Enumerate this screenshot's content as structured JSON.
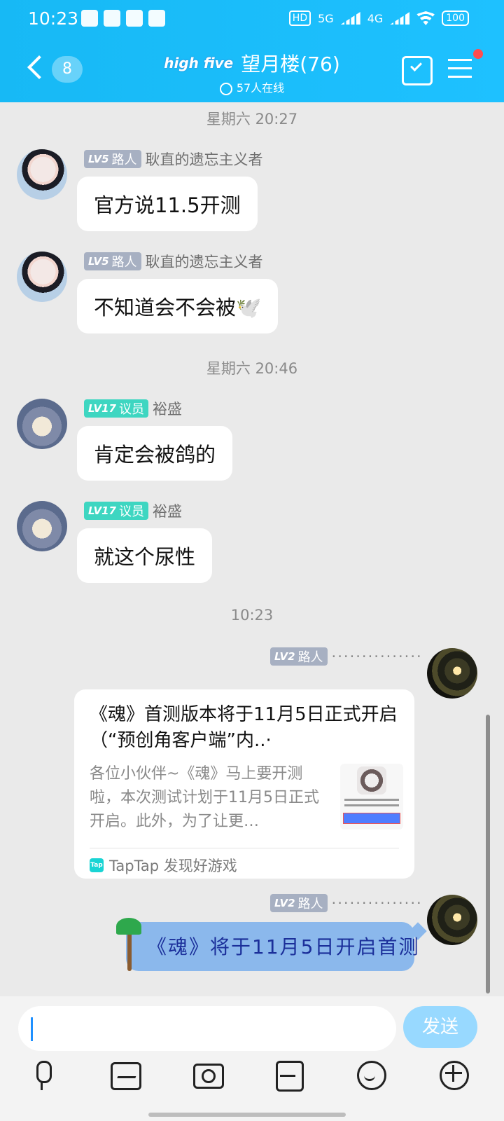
{
  "status": {
    "time": "10:23",
    "battery": "100",
    "network1": "5G",
    "network2": "4G",
    "hd_label": "HD"
  },
  "header": {
    "unread_count": "8",
    "logo_text": "high five",
    "group_title": "望月楼(76)",
    "online": "57人在线"
  },
  "timestamps": {
    "t1": "星期六 20:27",
    "t2": "星期六 20:46",
    "t3": "10:23"
  },
  "messages": [
    {
      "level": "LV5",
      "role": "路人",
      "user": "耿直的遗忘主义者",
      "text": "官方说11.5开测"
    },
    {
      "level": "LV5",
      "role": "路人",
      "user": "耿直的遗忘主义者",
      "text": "不知道会不会被🕊️"
    },
    {
      "level": "LV17",
      "role": "议员",
      "user": "裕盛",
      "text": "肯定会被鸽的"
    },
    {
      "level": "LV17",
      "role": "议员",
      "user": "裕盛",
      "text": "就这个尿性"
    }
  ],
  "me": {
    "level": "LV2",
    "role": "路人",
    "dots": "···············"
  },
  "card": {
    "title": "《魂》首测版本将于11月5日正式开启（“预创角客户端”内..·",
    "desc": "各位小伙伴~《魂》马上要开测啦，本次测试计划于11月5日正式开启。此外，为了让更…",
    "source_icon": "Tap",
    "source": "TapTap 发现好游戏"
  },
  "fancy_message": {
    "text": "《魂》将于11月5日开启首测"
  },
  "input": {
    "send_label": "发送"
  }
}
